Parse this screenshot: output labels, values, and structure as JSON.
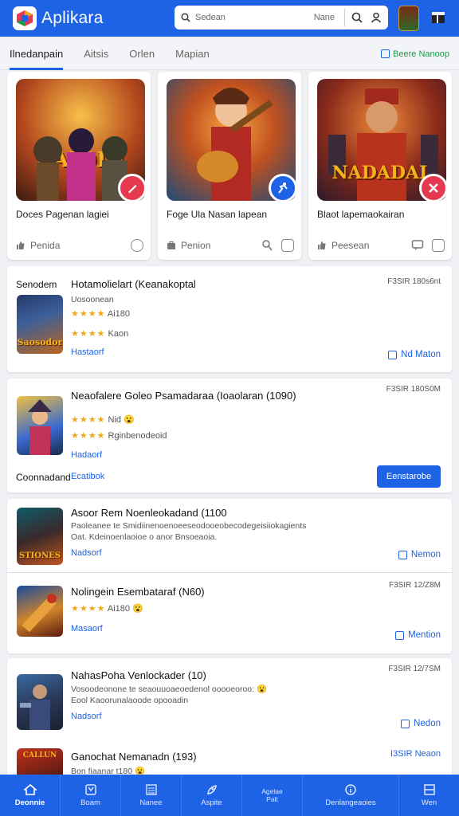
{
  "app": {
    "title": "Aplikara"
  },
  "search": {
    "placeholder": "Sedean",
    "filter_label": "Nane"
  },
  "tabs": [
    {
      "label": "Ilnedanpain",
      "active": true
    },
    {
      "label": "Aitsis",
      "active": false
    },
    {
      "label": "Orlen",
      "active": false
    },
    {
      "label": "Mapian",
      "active": false
    }
  ],
  "tabs_action": {
    "label": "Beere Nanoop"
  },
  "featured": [
    {
      "title": "Doces Pagenan lagiei",
      "image_text": "RAIDIN",
      "meta": "Penida",
      "badge_color": "#e53950",
      "image_bg": "#7a3a1c"
    },
    {
      "title": "Foge Ula Nasan lapean",
      "image_text": "",
      "meta": "Penion",
      "badge_color": "#1e63e6",
      "image_bg": "#1f5b8a"
    },
    {
      "title": "Blaot lapemaokairan",
      "image_text": "NADADAL",
      "meta": "Peesean",
      "badge_color": "#e53950",
      "image_bg": "#5a1f1f"
    }
  ],
  "list": [
    {
      "category": "Senodem",
      "title": "Hotamolielart (Keanakoptal",
      "subtitle": "Uosoonean",
      "stars1": "★★★★",
      "rating1": "Ai180",
      "stars2": "★★★★",
      "rating2": "Kaon",
      "link": "Hastaorf",
      "date": "F3SIR 180s6nt",
      "tag": "Nd Maton",
      "image_text": "Saosodor"
    },
    {
      "title": "Neaofalere Goleo Psamadaraa (Ioaolaran (1090)",
      "stars1": "★★★★",
      "rating1": "Nid 😮",
      "stars2": "★★★★",
      "rating2": "Rginbenodeoid",
      "link": "Hadaorf",
      "date": "F3SIR 180S0M",
      "cat_label": "Coonnadand",
      "cat_link": "Ecatibok",
      "button": "Eenstarobe"
    },
    {
      "title": "Asoor Rem Noenleokadand (1100",
      "desc1": "Paoleanee te Smidiinenoenoeeseodooeobecodegeisiiokagients",
      "desc2": "Oat. Kdeinoenlaoioe o anor Bnsoeaoia.",
      "link": "Nadsorf",
      "tag": "Nemon",
      "image_text": "STIONES"
    },
    {
      "title": "Nolingein Esembataraf (N60)",
      "stars1": "★★★★",
      "rating1": "Ai180 😮",
      "link": "Masaorf",
      "date": "F3SIR 12/Z8M",
      "tag": "Mention"
    },
    {
      "title": "NahasPoha Venlockader (10)",
      "desc1": "Vosoodeonone te seaouuoaeoedenol ooooeoroo: 😮",
      "desc2": "Eool Kaoorunalaoode opooadin",
      "link": "Nadsorf",
      "date": "F3SIR 12/7SM",
      "tag": "Nedon"
    },
    {
      "title": "Ganochat Nemanadn (193)",
      "subtitle": "Bon fiaanar t180 😮",
      "date": "I3SIR Neaon",
      "image_text": "CALLUN"
    }
  ],
  "bottom_nav": [
    {
      "label": "Deonnie",
      "active": true,
      "icon": "home-icon"
    },
    {
      "label": "Boam",
      "active": false,
      "icon": "puzzle-icon"
    },
    {
      "label": "Nanee",
      "active": false,
      "icon": "list-icon"
    },
    {
      "label": "Aspite",
      "active": false,
      "icon": "rocket-icon"
    },
    {
      "label": "Agelae\nPalt",
      "active": false,
      "icon": ""
    },
    {
      "label": "Denlangeaoies",
      "active": false,
      "icon": "info-icon"
    },
    {
      "label": "Wen",
      "active": false,
      "icon": "window-icon"
    }
  ],
  "colors": {
    "primary": "#1e63e6",
    "star": "#f0a81a",
    "accent_red": "#e53950"
  }
}
